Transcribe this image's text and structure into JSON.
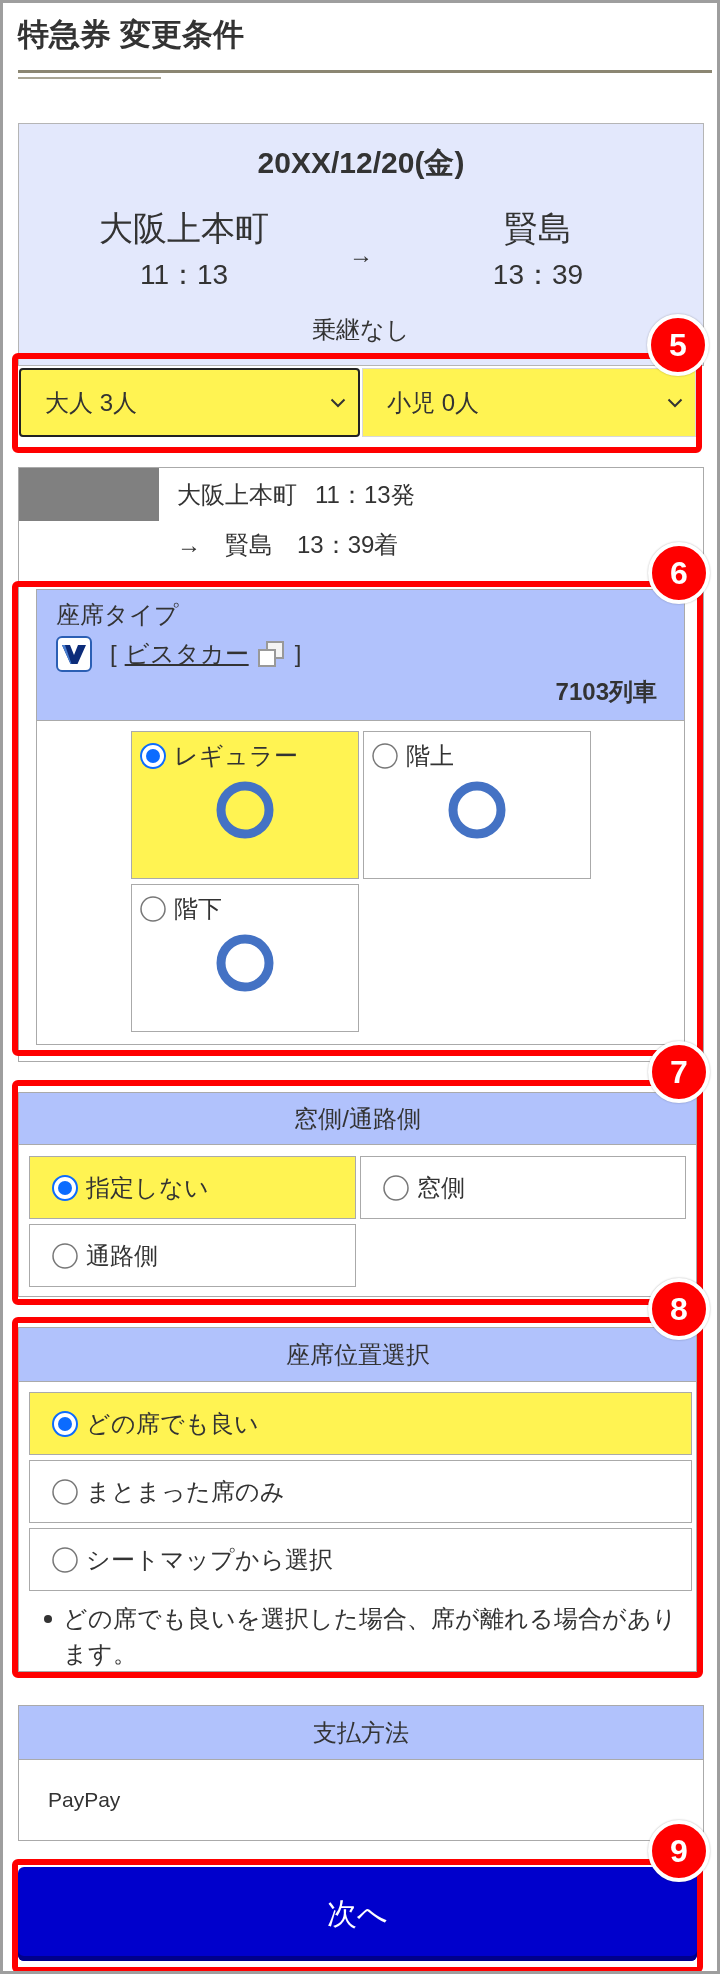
{
  "header": {
    "title": "特急券 変更条件"
  },
  "trip": {
    "date": "20XX/12/20(金)",
    "departure": {
      "station": "大阪上本町",
      "time": "11：13"
    },
    "arrow": "→",
    "arrival": {
      "station": "賢島",
      "time": "13：39"
    },
    "transfer": "乗継なし"
  },
  "passengers": {
    "callout": "5",
    "selects": [
      {
        "value": "大人 3人",
        "focused": true
      },
      {
        "value": "小児 0人",
        "focused": false
      }
    ]
  },
  "train": {
    "departure": {
      "station": "大阪上本町",
      "time": "11：13発"
    },
    "arrival": {
      "arrow": "→",
      "station": "賢島",
      "time": "13：39着"
    }
  },
  "seat_type": {
    "callout": "6",
    "label": "座席タイプ",
    "bracket_open": "[",
    "link": "ビスタカー",
    "bracket_close": "]",
    "train_number": "7103列車",
    "options": [
      {
        "label": "レギュラー",
        "selected": true,
        "available": true
      },
      {
        "label": "階上",
        "selected": false,
        "available": true
      },
      {
        "label": "階下",
        "selected": false,
        "available": true
      }
    ]
  },
  "window_aisle": {
    "callout": "7",
    "title": "窓側/通路側",
    "options": [
      {
        "label": "指定しない",
        "selected": true
      },
      {
        "label": "窓側",
        "selected": false
      },
      {
        "label": "通路側",
        "selected": false
      }
    ]
  },
  "seat_position": {
    "callout": "8",
    "title": "座席位置選択",
    "options": [
      {
        "label": "どの席でも良い",
        "selected": true
      },
      {
        "label": "まとまった席のみ",
        "selected": false
      },
      {
        "label": "シートマップから選択",
        "selected": false
      }
    ],
    "notes": [
      "どの席でも良いを選択した場合、席が離れる場合があります。"
    ]
  },
  "payment": {
    "title": "支払方法",
    "value": "PayPay"
  },
  "next_button": {
    "callout": "9",
    "label": "次へ"
  }
}
